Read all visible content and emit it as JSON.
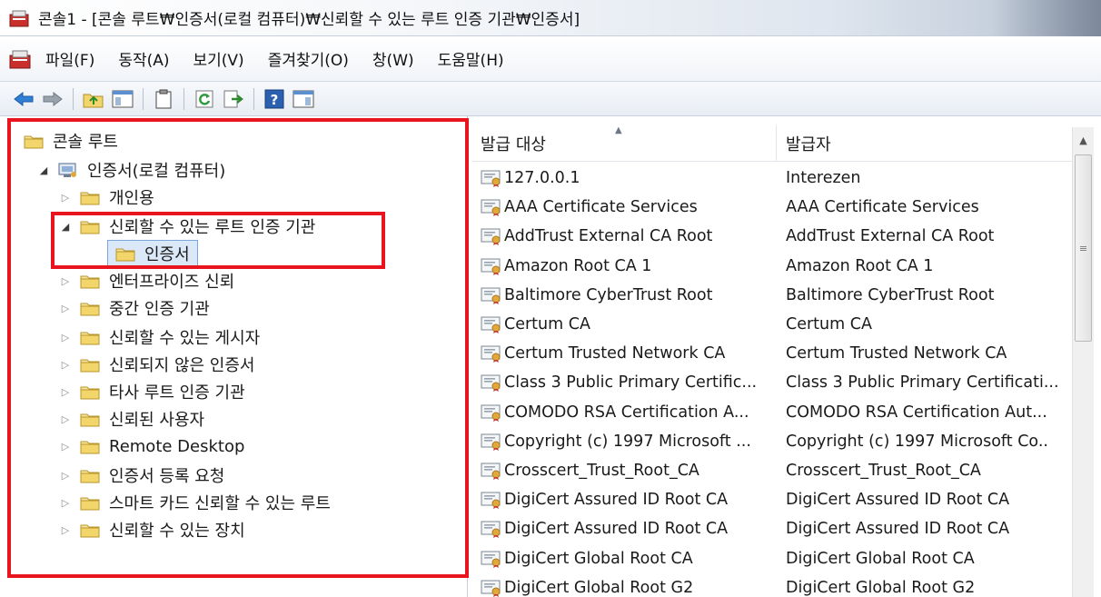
{
  "window": {
    "title": "콘솔1 - [콘솔 루트₩인증서(로컬 컴퓨터)₩신뢰할 수 있는 루트 인증 기관₩인증서]"
  },
  "menu": [
    "파일(F)",
    "동작(A)",
    "보기(V)",
    "즐겨찾기(O)",
    "창(W)",
    "도움말(H)"
  ],
  "toolbar": {
    "icons": [
      "back-arrow-icon",
      "forward-arrow-icon",
      "up-folder-icon",
      "show-hide-tree-icon",
      "clipboard-icon",
      "refresh-icon",
      "export-list-icon",
      "help-icon",
      "action-pane-icon"
    ]
  },
  "tree": {
    "root": "콘솔 루트",
    "computer": "인증서(로컬 컴퓨터)",
    "items": [
      "개인용",
      "신뢰할 수 있는 루트 인증 기관",
      "인증서",
      "엔터프라이즈 신뢰",
      "중간 인증 기관",
      "신뢰할 수 있는 게시자",
      "신뢰되지 않은 인증서",
      "타사 루트 인증 기관",
      "신뢰된 사용자",
      "Remote Desktop",
      "인증서 등록 요청",
      "스마트 카드 신뢰할 수 있는 루트",
      "신뢰할 수 있는 장치"
    ]
  },
  "list": {
    "columns": [
      "발급 대상",
      "발급자"
    ],
    "rows": [
      [
        "127.0.0.1",
        "Interezen"
      ],
      [
        "AAA Certificate Services",
        "AAA Certificate Services"
      ],
      [
        "AddTrust External CA Root",
        "AddTrust External CA Root"
      ],
      [
        "Amazon Root CA 1",
        "Amazon Root CA 1"
      ],
      [
        "Baltimore CyberTrust Root",
        "Baltimore CyberTrust Root"
      ],
      [
        "Certum CA",
        "Certum CA"
      ],
      [
        "Certum Trusted Network CA",
        "Certum Trusted Network CA"
      ],
      [
        "Class 3 Public Primary Certific...",
        "Class 3 Public Primary Certificati..."
      ],
      [
        "COMODO RSA Certification A...",
        "COMODO RSA Certification Aut..."
      ],
      [
        "Copyright (c) 1997 Microsoft ...",
        "Copyright (c) 1997 Microsoft Co.."
      ],
      [
        "Crosscert_Trust_Root_CA",
        "Crosscert_Trust_Root_CA"
      ],
      [
        "DigiCert Assured ID Root CA",
        "DigiCert Assured ID Root CA"
      ],
      [
        "DigiCert Assured ID Root CA",
        "DigiCert Assured ID Root CA"
      ],
      [
        "DigiCert Global Root CA",
        "DigiCert Global Root CA"
      ],
      [
        "DigiCert Global Root G2",
        "DigiCert Global Root G2"
      ]
    ]
  },
  "colors": {
    "highlight_frame": "#e8141e",
    "folder": "#f3d66b",
    "selection": "#dbe8f7"
  }
}
